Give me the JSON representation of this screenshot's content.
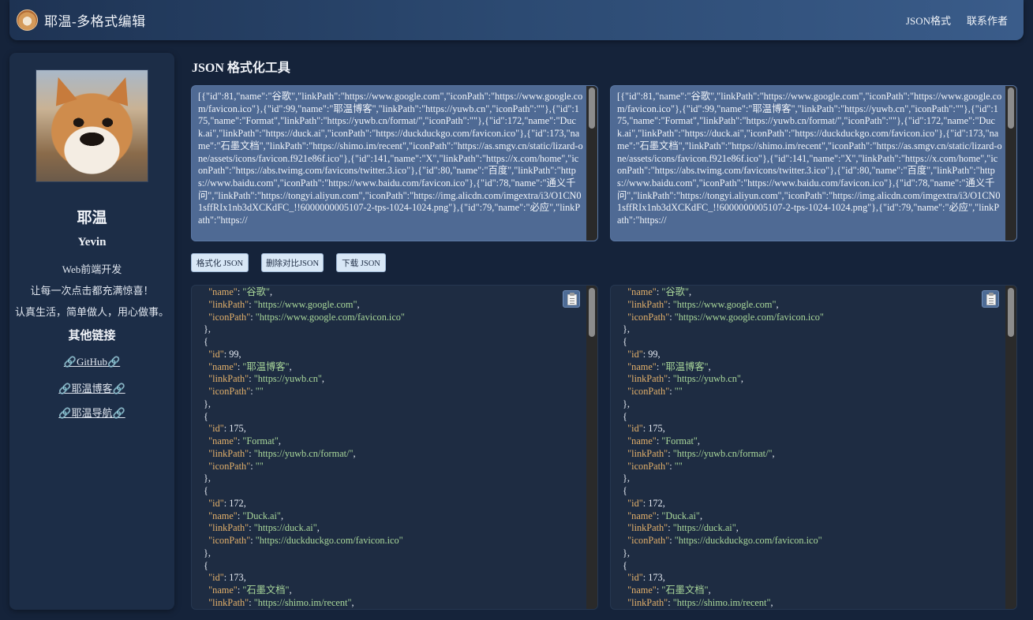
{
  "header": {
    "site_title": "耶温-多格式编辑",
    "nav": [
      "JSON格式",
      "联系作者"
    ]
  },
  "sidebar": {
    "name": "耶温",
    "english_name": "Yevin",
    "role": "Web前端开发",
    "motto1": "让每一次点击都充满惊喜！",
    "motto2": "认真生活，简单做人，用心做事。",
    "other_links_title": "其他链接",
    "links": [
      "🔗GitHub🔗",
      "🔗耶温博客🔗",
      "🔗耶温导航🔗"
    ]
  },
  "main": {
    "title": "JSON 格式化工具",
    "raw_text": "[{\"id\":81,\"name\":\"谷歌\",\"linkPath\":\"https://www.google.com\",\"iconPath\":\"https://www.google.com/favicon.ico\"},{\"id\":99,\"name\":\"耶温博客\",\"linkPath\":\"https://yuwb.cn\",\"iconPath\":\"\"},{\"id\":175,\"name\":\"Format\",\"linkPath\":\"https://yuwb.cn/format/\",\"iconPath\":\"\"},{\"id\":172,\"name\":\"Duck.ai\",\"linkPath\":\"https://duck.ai\",\"iconPath\":\"https://duckduckgo.com/favicon.ico\"},{\"id\":173,\"name\":\"石墨文档\",\"linkPath\":\"https://shimo.im/recent\",\"iconPath\":\"https://as.smgv.cn/static/lizard-one/assets/icons/favicon.f921e86f.ico\"},{\"id\":141,\"name\":\"X\",\"linkPath\":\"https://x.com/home\",\"iconPath\":\"https://abs.twimg.com/favicons/twitter.3.ico\"},{\"id\":80,\"name\":\"百度\",\"linkPath\":\"https://www.baidu.com\",\"iconPath\":\"https://www.baidu.com/favicon.ico\"},{\"id\":78,\"name\":\"通义千问\",\"linkPath\":\"https://tongyi.aliyun.com\",\"iconPath\":\"https://img.alicdn.com/imgextra/i3/O1CN01sffRIx1nb3dXCKdFC_!!6000000005107-2-tps-1024-1024.png\"},{\"id\":79,\"name\":\"必应\",\"linkPath\":\"https://",
    "buttons": {
      "format": "格式化 JSON",
      "delete_compare": "删除对比JSON",
      "download": "下载 JSON"
    },
    "formatted_lines": [
      [
        [
          "k",
          "\"name\""
        ],
        [
          "p",
          ": "
        ],
        [
          "s",
          "\"谷歌\""
        ],
        [
          "p",
          ","
        ]
      ],
      [
        [
          "k",
          "\"linkPath\""
        ],
        [
          "p",
          ": "
        ],
        [
          "s",
          "\"https://www.google.com\""
        ],
        [
          "p",
          ","
        ]
      ],
      [
        [
          "k",
          "\"iconPath\""
        ],
        [
          "p",
          ": "
        ],
        [
          "s",
          "\"https://www.google.com/favicon.ico\""
        ]
      ],
      [
        [
          "p",
          "},"
        ]
      ],
      [
        [
          "p",
          "{"
        ]
      ],
      [
        [
          "k",
          "\"id\""
        ],
        [
          "p",
          ": 99,"
        ]
      ],
      [
        [
          "k",
          "\"name\""
        ],
        [
          "p",
          ": "
        ],
        [
          "s",
          "\"耶温博客\""
        ],
        [
          "p",
          ","
        ]
      ],
      [
        [
          "k",
          "\"linkPath\""
        ],
        [
          "p",
          ": "
        ],
        [
          "s",
          "\"https://yuwb.cn\""
        ],
        [
          "p",
          ","
        ]
      ],
      [
        [
          "k",
          "\"iconPath\""
        ],
        [
          "p",
          ": "
        ],
        [
          "s",
          "\"\""
        ]
      ],
      [
        [
          "p",
          "},"
        ]
      ],
      [
        [
          "p",
          "{"
        ]
      ],
      [
        [
          "k",
          "\"id\""
        ],
        [
          "p",
          ": 175,"
        ]
      ],
      [
        [
          "k",
          "\"name\""
        ],
        [
          "p",
          ": "
        ],
        [
          "s",
          "\"Format\""
        ],
        [
          "p",
          ","
        ]
      ],
      [
        [
          "k",
          "\"linkPath\""
        ],
        [
          "p",
          ": "
        ],
        [
          "s",
          "\"https://yuwb.cn/format/\""
        ],
        [
          "p",
          ","
        ]
      ],
      [
        [
          "k",
          "\"iconPath\""
        ],
        [
          "p",
          ": "
        ],
        [
          "s",
          "\"\""
        ]
      ],
      [
        [
          "p",
          "},"
        ]
      ],
      [
        [
          "p",
          "{"
        ]
      ],
      [
        [
          "k",
          "\"id\""
        ],
        [
          "p",
          ": 172,"
        ]
      ],
      [
        [
          "k",
          "\"name\""
        ],
        [
          "p",
          ": "
        ],
        [
          "s",
          "\"Duck.ai\""
        ],
        [
          "p",
          ","
        ]
      ],
      [
        [
          "k",
          "\"linkPath\""
        ],
        [
          "p",
          ": "
        ],
        [
          "s",
          "\"https://duck.ai\""
        ],
        [
          "p",
          ","
        ]
      ],
      [
        [
          "k",
          "\"iconPath\""
        ],
        [
          "p",
          ": "
        ],
        [
          "s",
          "\"https://duckduckgo.com/favicon.ico\""
        ]
      ],
      [
        [
          "p",
          "},"
        ]
      ],
      [
        [
          "p",
          "{"
        ]
      ],
      [
        [
          "k",
          "\"id\""
        ],
        [
          "p",
          ": 173,"
        ]
      ],
      [
        [
          "k",
          "\"name\""
        ],
        [
          "p",
          ": "
        ],
        [
          "s",
          "\"石墨文档\""
        ],
        [
          "p",
          ","
        ]
      ],
      [
        [
          "k",
          "\"linkPath\""
        ],
        [
          "p",
          ": "
        ],
        [
          "s",
          "\"https://shimo.im/recent\""
        ],
        [
          "p",
          ","
        ]
      ]
    ],
    "formatted_indent": [
      1,
      1,
      1,
      0,
      0,
      1,
      1,
      1,
      1,
      0,
      0,
      1,
      1,
      1,
      1,
      0,
      0,
      1,
      1,
      1,
      1,
      0,
      0,
      1,
      1,
      1
    ]
  },
  "icons": {
    "logo": "shiba-dog-logo",
    "avatar": "shiba-dog-avatar",
    "copy": "clipboard-icon"
  },
  "colors": {
    "background": "#15233a",
    "panel": "#1c2d47",
    "raw_input": "#4f6a94",
    "json_key": "#e3b06a",
    "json_string": "#a9d79a",
    "button": "#d8e7f6"
  }
}
